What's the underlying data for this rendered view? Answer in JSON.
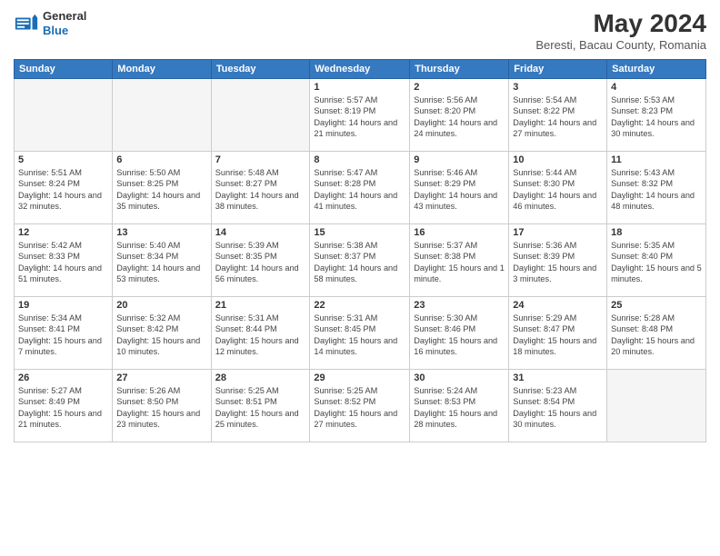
{
  "header": {
    "logo": {
      "general": "General",
      "blue": "Blue"
    },
    "title": "May 2024",
    "location": "Beresti, Bacau County, Romania"
  },
  "weekdays": [
    "Sunday",
    "Monday",
    "Tuesday",
    "Wednesday",
    "Thursday",
    "Friday",
    "Saturday"
  ],
  "weeks": [
    [
      null,
      null,
      null,
      {
        "day": 1,
        "sunrise": "5:57 AM",
        "sunset": "8:19 PM",
        "daylight": "14 hours and 21 minutes."
      },
      {
        "day": 2,
        "sunrise": "5:56 AM",
        "sunset": "8:20 PM",
        "daylight": "14 hours and 24 minutes."
      },
      {
        "day": 3,
        "sunrise": "5:54 AM",
        "sunset": "8:22 PM",
        "daylight": "14 hours and 27 minutes."
      },
      {
        "day": 4,
        "sunrise": "5:53 AM",
        "sunset": "8:23 PM",
        "daylight": "14 hours and 30 minutes."
      }
    ],
    [
      {
        "day": 5,
        "sunrise": "5:51 AM",
        "sunset": "8:24 PM",
        "daylight": "14 hours and 32 minutes."
      },
      {
        "day": 6,
        "sunrise": "5:50 AM",
        "sunset": "8:25 PM",
        "daylight": "14 hours and 35 minutes."
      },
      {
        "day": 7,
        "sunrise": "5:48 AM",
        "sunset": "8:27 PM",
        "daylight": "14 hours and 38 minutes."
      },
      {
        "day": 8,
        "sunrise": "5:47 AM",
        "sunset": "8:28 PM",
        "daylight": "14 hours and 41 minutes."
      },
      {
        "day": 9,
        "sunrise": "5:46 AM",
        "sunset": "8:29 PM",
        "daylight": "14 hours and 43 minutes."
      },
      {
        "day": 10,
        "sunrise": "5:44 AM",
        "sunset": "8:30 PM",
        "daylight": "14 hours and 46 minutes."
      },
      {
        "day": 11,
        "sunrise": "5:43 AM",
        "sunset": "8:32 PM",
        "daylight": "14 hours and 48 minutes."
      }
    ],
    [
      {
        "day": 12,
        "sunrise": "5:42 AM",
        "sunset": "8:33 PM",
        "daylight": "14 hours and 51 minutes."
      },
      {
        "day": 13,
        "sunrise": "5:40 AM",
        "sunset": "8:34 PM",
        "daylight": "14 hours and 53 minutes."
      },
      {
        "day": 14,
        "sunrise": "5:39 AM",
        "sunset": "8:35 PM",
        "daylight": "14 hours and 56 minutes."
      },
      {
        "day": 15,
        "sunrise": "5:38 AM",
        "sunset": "8:37 PM",
        "daylight": "14 hours and 58 minutes."
      },
      {
        "day": 16,
        "sunrise": "5:37 AM",
        "sunset": "8:38 PM",
        "daylight": "15 hours and 1 minute."
      },
      {
        "day": 17,
        "sunrise": "5:36 AM",
        "sunset": "8:39 PM",
        "daylight": "15 hours and 3 minutes."
      },
      {
        "day": 18,
        "sunrise": "5:35 AM",
        "sunset": "8:40 PM",
        "daylight": "15 hours and 5 minutes."
      }
    ],
    [
      {
        "day": 19,
        "sunrise": "5:34 AM",
        "sunset": "8:41 PM",
        "daylight": "15 hours and 7 minutes."
      },
      {
        "day": 20,
        "sunrise": "5:32 AM",
        "sunset": "8:42 PM",
        "daylight": "15 hours and 10 minutes."
      },
      {
        "day": 21,
        "sunrise": "5:31 AM",
        "sunset": "8:44 PM",
        "daylight": "15 hours and 12 minutes."
      },
      {
        "day": 22,
        "sunrise": "5:31 AM",
        "sunset": "8:45 PM",
        "daylight": "15 hours and 14 minutes."
      },
      {
        "day": 23,
        "sunrise": "5:30 AM",
        "sunset": "8:46 PM",
        "daylight": "15 hours and 16 minutes."
      },
      {
        "day": 24,
        "sunrise": "5:29 AM",
        "sunset": "8:47 PM",
        "daylight": "15 hours and 18 minutes."
      },
      {
        "day": 25,
        "sunrise": "5:28 AM",
        "sunset": "8:48 PM",
        "daylight": "15 hours and 20 minutes."
      }
    ],
    [
      {
        "day": 26,
        "sunrise": "5:27 AM",
        "sunset": "8:49 PM",
        "daylight": "15 hours and 21 minutes."
      },
      {
        "day": 27,
        "sunrise": "5:26 AM",
        "sunset": "8:50 PM",
        "daylight": "15 hours and 23 minutes."
      },
      {
        "day": 28,
        "sunrise": "5:25 AM",
        "sunset": "8:51 PM",
        "daylight": "15 hours and 25 minutes."
      },
      {
        "day": 29,
        "sunrise": "5:25 AM",
        "sunset": "8:52 PM",
        "daylight": "15 hours and 27 minutes."
      },
      {
        "day": 30,
        "sunrise": "5:24 AM",
        "sunset": "8:53 PM",
        "daylight": "15 hours and 28 minutes."
      },
      {
        "day": 31,
        "sunrise": "5:23 AM",
        "sunset": "8:54 PM",
        "daylight": "15 hours and 30 minutes."
      },
      null
    ]
  ]
}
